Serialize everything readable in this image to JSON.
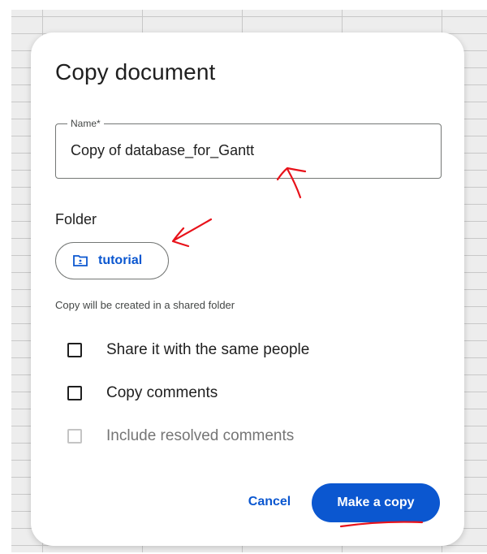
{
  "dialog": {
    "title": "Copy document",
    "name_field": {
      "label": "Name*",
      "value": "Copy of database_for_Gantt"
    },
    "folder": {
      "heading": "Folder",
      "chip_label": "tutorial",
      "chip_icon": "shared-folder-icon",
      "helper": "Copy will be created in a shared folder"
    },
    "options": [
      {
        "label": "Share it with the same people",
        "checked": false,
        "enabled": true
      },
      {
        "label": "Copy comments",
        "checked": false,
        "enabled": true
      },
      {
        "label": "Include resolved comments",
        "checked": false,
        "enabled": false
      }
    ],
    "buttons": {
      "cancel": "Cancel",
      "primary": "Make a copy"
    }
  },
  "colors": {
    "accent": "#0b57d0",
    "annotation": "#e8121a",
    "backdrop": "#ededed"
  }
}
